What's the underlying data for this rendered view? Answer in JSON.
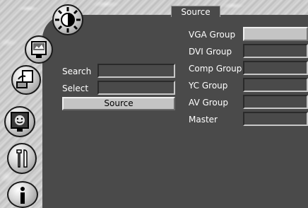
{
  "title": "Source",
  "left_panel": {
    "search_label": "Search",
    "select_label": "Select",
    "search_value": "",
    "select_value": "",
    "source_button_label": "Source"
  },
  "groups": [
    {
      "label": "VGA Group",
      "value": ""
    },
    {
      "label": "DVI Group",
      "value": ""
    },
    {
      "label": "Comp Group",
      "value": ""
    },
    {
      "label": "YC Group",
      "value": ""
    },
    {
      "label": "AV Group",
      "value": ""
    },
    {
      "label": "Master",
      "value": ""
    }
  ],
  "sidebar_icons": [
    "brightness-icon",
    "picture-icon",
    "input-icon",
    "display-face-icon",
    "tools-icon",
    "info-icon"
  ]
}
